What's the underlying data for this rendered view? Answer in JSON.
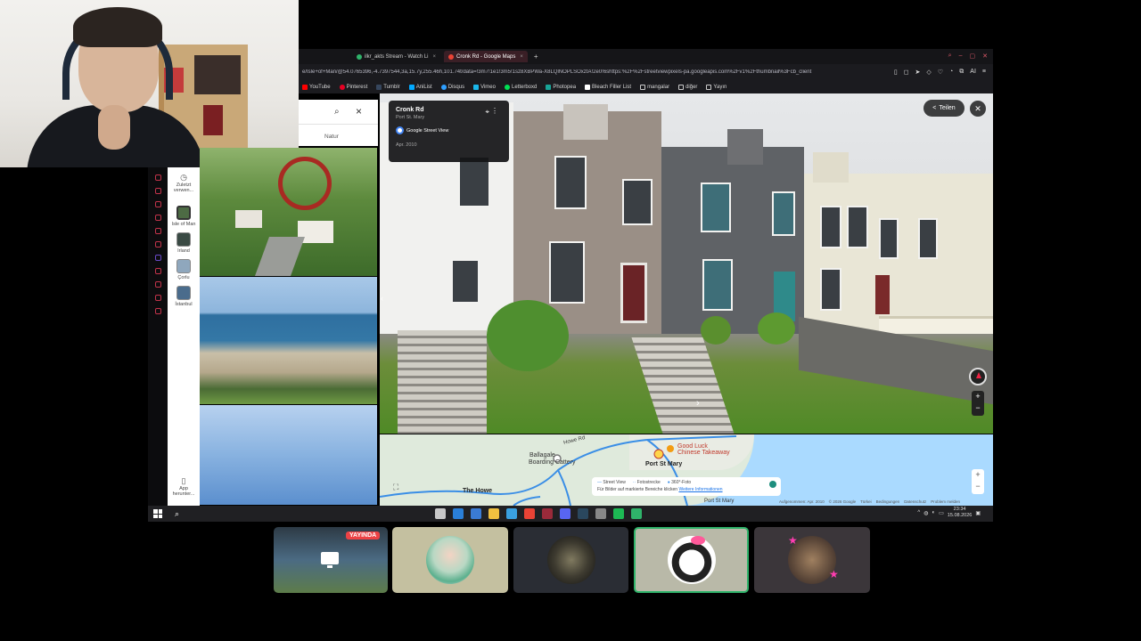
{
  "browser": {
    "tabs": [
      {
        "label": "ilkr_akts Stream - Watch Li",
        "color": "#2fb36a",
        "active": false
      },
      {
        "label": "Cronk Rd - Google Maps",
        "color": "#ea4335",
        "active": true
      }
    ],
    "new_tab": "+",
    "url": "e/Isle+of+Man/@54.0765396,-4.7397544,3a,15.7y,255.46h,101.74t/data=!3m7!1e1!3m5!1sz8XBPWa-X8LQlNOPLSOxztA!2e0!6shttps:%2F%2Fstreetviewpixels-pa.googleapis.com%2Fv1%2Fthumbnail%3Fcb_client",
    "bookmarks": [
      {
        "label": "YouTube",
        "color": "#ff0000"
      },
      {
        "label": "Pinterest",
        "color": "#e60023"
      },
      {
        "label": "Tumblr",
        "color": "#36465d"
      },
      {
        "label": "AniList",
        "color": "#02a9ff"
      },
      {
        "label": "Disqus",
        "color": "#2e9fff"
      },
      {
        "label": "Vimeo",
        "color": "#1ab7ea"
      },
      {
        "label": "Letterboxd",
        "color": "#00e054"
      },
      {
        "label": "Photopea",
        "color": "#18a497"
      },
      {
        "label": "Bleach Filler List",
        "color": "#ffffff"
      },
      {
        "label": "mangalar",
        "color": "#cccccc"
      },
      {
        "label": "diğer",
        "color": "#cccccc"
      },
      {
        "label": "Yayın",
        "color": "#cccccc"
      }
    ],
    "toolbar_ai": "AI"
  },
  "maps_panel": {
    "category_label": "Natur",
    "side_items": [
      {
        "label": "Zuletzt verwen..."
      },
      {
        "label": "Isle of Man"
      },
      {
        "label": "Irland"
      },
      {
        "label": "Çorlu"
      },
      {
        "label": "İstanbul"
      },
      {
        "label": "App herunter..."
      }
    ]
  },
  "streetview": {
    "street_name": "Cronk Rd",
    "locality": "Port St. Mary",
    "source": "Google Street View",
    "capture_date": "Apr. 2010",
    "share_label": "Teilen"
  },
  "map": {
    "labels": {
      "ballagale": "Ballagale",
      "boarding_cattery": "Boarding Cattery",
      "howe_rd": "Howe Rd",
      "good_luck": "Good Luck",
      "chinese_takeaway": "Chinese Takeaway",
      "port_st_mary": "Port St Mary",
      "the_howe": "The Howe",
      "port_st_mary_bottom": "Port St Mary"
    },
    "legend": {
      "street_view": "Street View",
      "fotostrecke": "Fotostrecke",
      "foto360": "360°-Foto",
      "hint": "Für Bilder auf markierte Bereiche klicken",
      "more_link": "Weitere Informationen"
    },
    "footer": [
      "Aufgenommen: Apr. 2010",
      "© 2026 Google",
      "Türkei",
      "Bedingungen",
      "Datenschutz",
      "Problem melden"
    ]
  },
  "taskbar": {
    "app_colors": [
      "#c8c8c8",
      "#2a7fd8",
      "#3a7bd5",
      "#f0c040",
      "#3aa0e0",
      "#e94335",
      "#9a2a3a",
      "#5865f2",
      "#2a475e",
      "#888888",
      "#1db954",
      "#2fb36a"
    ],
    "time": "23:34",
    "date": "15.08.2026"
  },
  "call": {
    "live_label": "YAYINDA"
  }
}
